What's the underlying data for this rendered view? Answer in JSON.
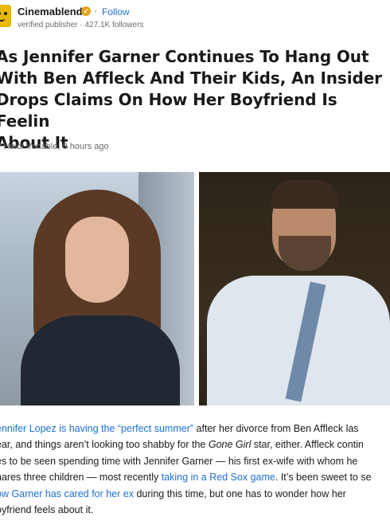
{
  "publisher": {
    "name": "Cinemablend",
    "follow_label": "Follow",
    "meta": "verified publisher · 427.1K followers",
    "separator": "·"
  },
  "article": {
    "headline": "As Jennifer Garner Continues To Hang Out\nWith Ben Affleck And Their Kids, An Insider\nDrops Claims On How Her Boyfriend Is Feelin\nAbout It",
    "byline": "y Heidi Venable, 9 hours ago",
    "hero_images": [
      {
        "description_icon": "photo-jennifer-garner"
      },
      {
        "description_icon": "photo-ben-affleck"
      }
    ],
    "body_lines": [
      {
        "segments": [
          {
            "text": "ennifer Lopez is having the “perfect summer”",
            "link": true
          },
          {
            "text": " after her divorce from Ben Affleck las",
            "link": false
          }
        ]
      },
      {
        "segments": [
          {
            "text": "ear, and things aren’t looking too shabby for the ",
            "link": false
          },
          {
            "text": "Gone Girl",
            "italic": true
          },
          {
            "text": " star, either. Affleck contin",
            "link": false
          }
        ]
      },
      {
        "segments": [
          {
            "text": "es to be seen spending time with Jennifer Garner — his first ex-wife with whom he",
            "link": false
          }
        ]
      },
      {
        "segments": [
          {
            "text": "hares three children — most recently ",
            "link": false
          },
          {
            "text": "taking in a Red Sox game",
            "link": true
          },
          {
            "text": ". It’s been sweet to se",
            "link": false
          }
        ]
      },
      {
        "segments": [
          {
            "text": "ow Garner has cared for her ex",
            "link": true
          },
          {
            "text": " during this time, but one has to wonder how her",
            "link": false
          }
        ]
      },
      {
        "segments": [
          {
            "text": "oyfriend feels about it.",
            "link": false
          }
        ]
      }
    ]
  },
  "colors": {
    "link": "#1f6fcf",
    "verified_badge": "#e8a317",
    "logo": "#e6b800"
  }
}
